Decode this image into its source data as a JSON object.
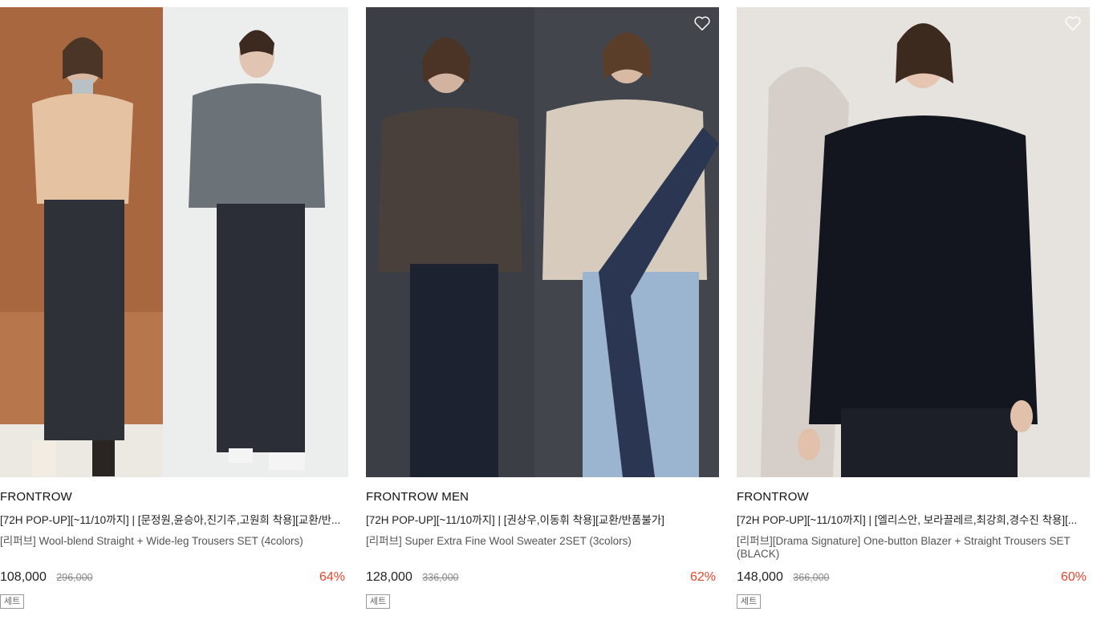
{
  "products": [
    {
      "brand": "FRONTROW",
      "promo": "[72H POP-UP][~11/10까지] | [문정원,윤승아,진기주,고원희 착용][교환/반...",
      "name": "[리퍼브] Wool-blend Straight + Wide-leg Trousers SET (4colors)",
      "price": "108,000",
      "original_price": "296,000",
      "discount": "64%",
      "tag": "세트",
      "has_heart": false
    },
    {
      "brand": "FRONTROW MEN",
      "promo": "[72H POP-UP][~11/10까지] | [권상우,이동휘 착용][교환/반품불가]",
      "name": "[리퍼브] Super Extra Fine Wool Sweater 2SET (3colors)",
      "price": "128,000",
      "original_price": "336,000",
      "discount": "62%",
      "tag": "세트",
      "has_heart": true
    },
    {
      "brand": "FRONTROW",
      "promo": "[72H POP-UP][~11/10까지] | [엘리스안, 보라끌레르,최강희,경수진 착용][...",
      "name": "[리퍼브][Drama Signature] One-button Blazer + Straight Trousers SET (BLACK)",
      "price": "148,000",
      "original_price": "366,000",
      "discount": "60%",
      "tag": "세트",
      "has_heart": true
    }
  ],
  "colors": {
    "discount": "#e8442c",
    "text": "#111111",
    "muted": "#888888"
  },
  "icons": {
    "wishlist": "heart-outline-icon"
  }
}
